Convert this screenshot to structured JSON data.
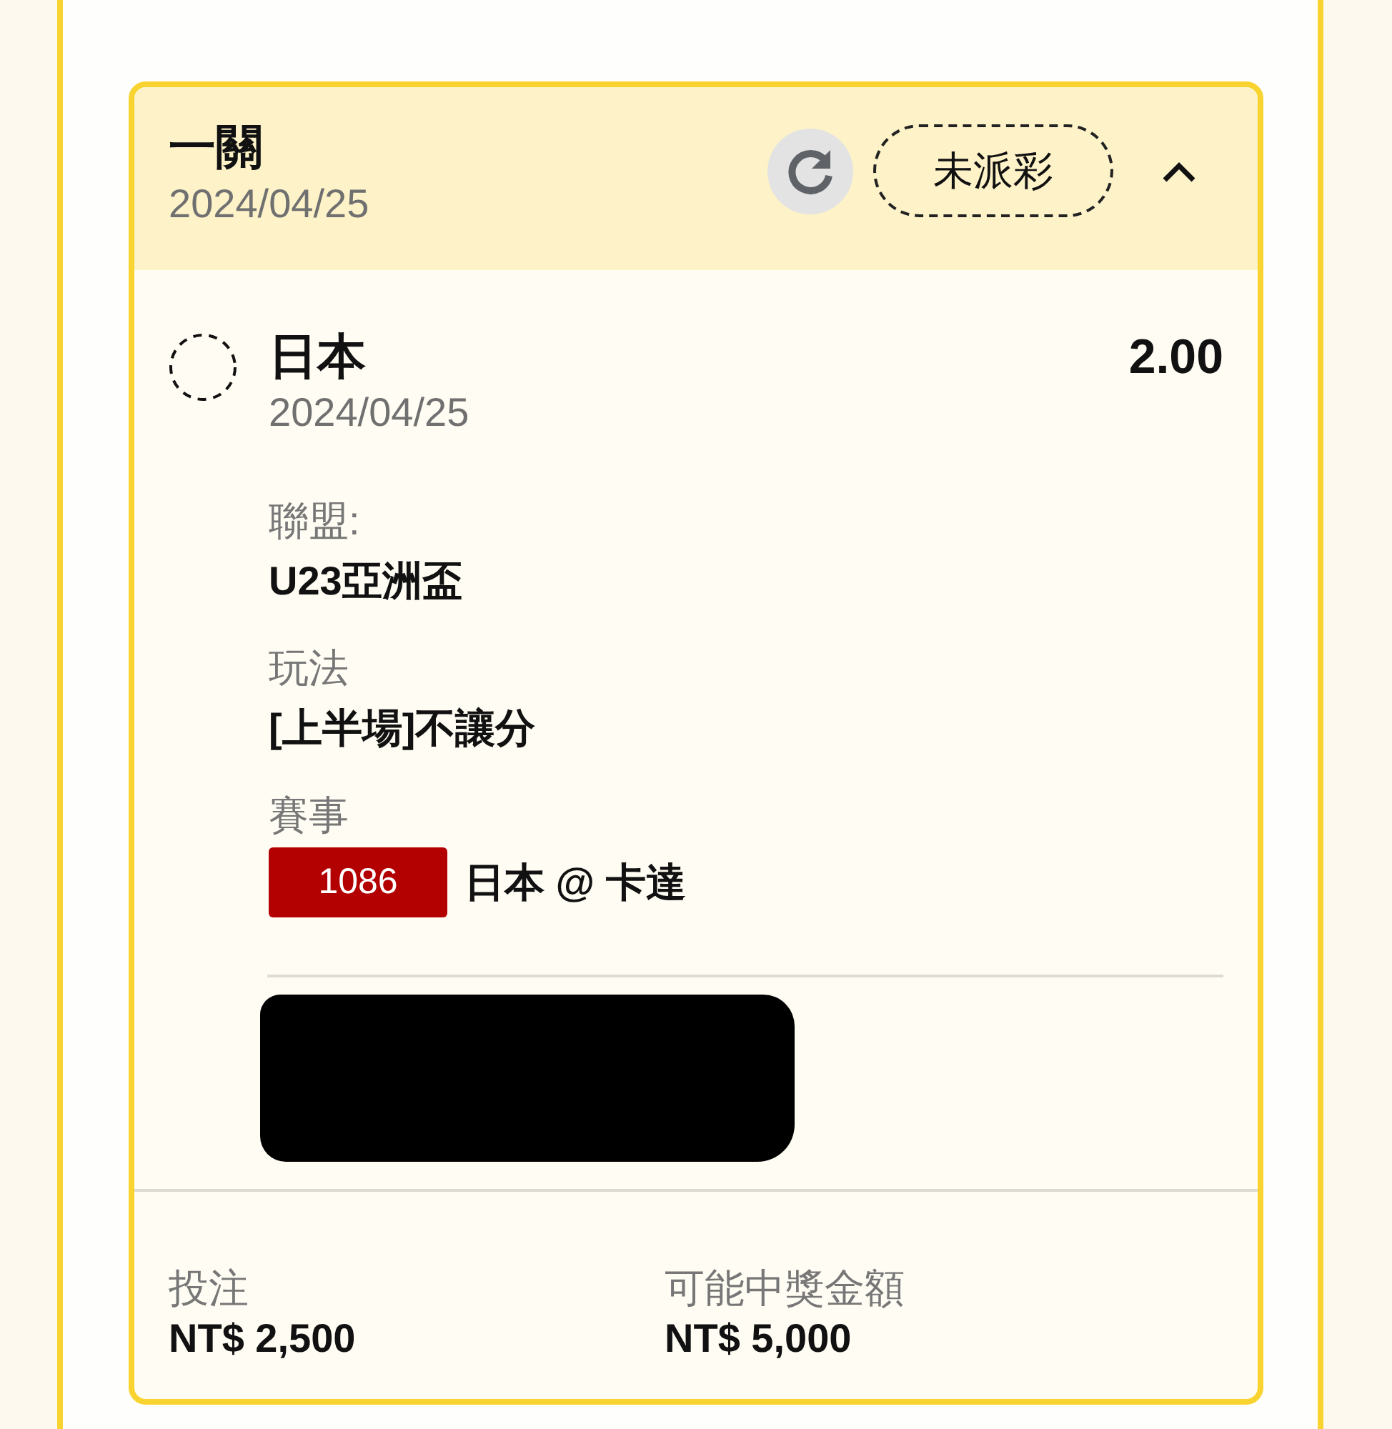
{
  "bet_card": {
    "title": "一關",
    "date": "2024/04/25",
    "status": "未派彩",
    "expanded": true
  },
  "selections": [
    {
      "team": "日本",
      "date": "2024/04/25",
      "odds": "2.00",
      "details": [
        {
          "kind": "text",
          "label": "聯盟:",
          "value": "U23亞洲盃"
        },
        {
          "kind": "text",
          "label": "玩法",
          "value": "[上半場]不讓分"
        },
        {
          "kind": "match",
          "label": "賽事",
          "code": "1086",
          "value": "日本 @ 卡達"
        }
      ],
      "redacted": true
    }
  ],
  "summary": [
    {
      "label": "投注",
      "value": "NT$ 2,500"
    },
    {
      "label": "可能中獎金額",
      "value": "NT$ 5,000"
    }
  ]
}
